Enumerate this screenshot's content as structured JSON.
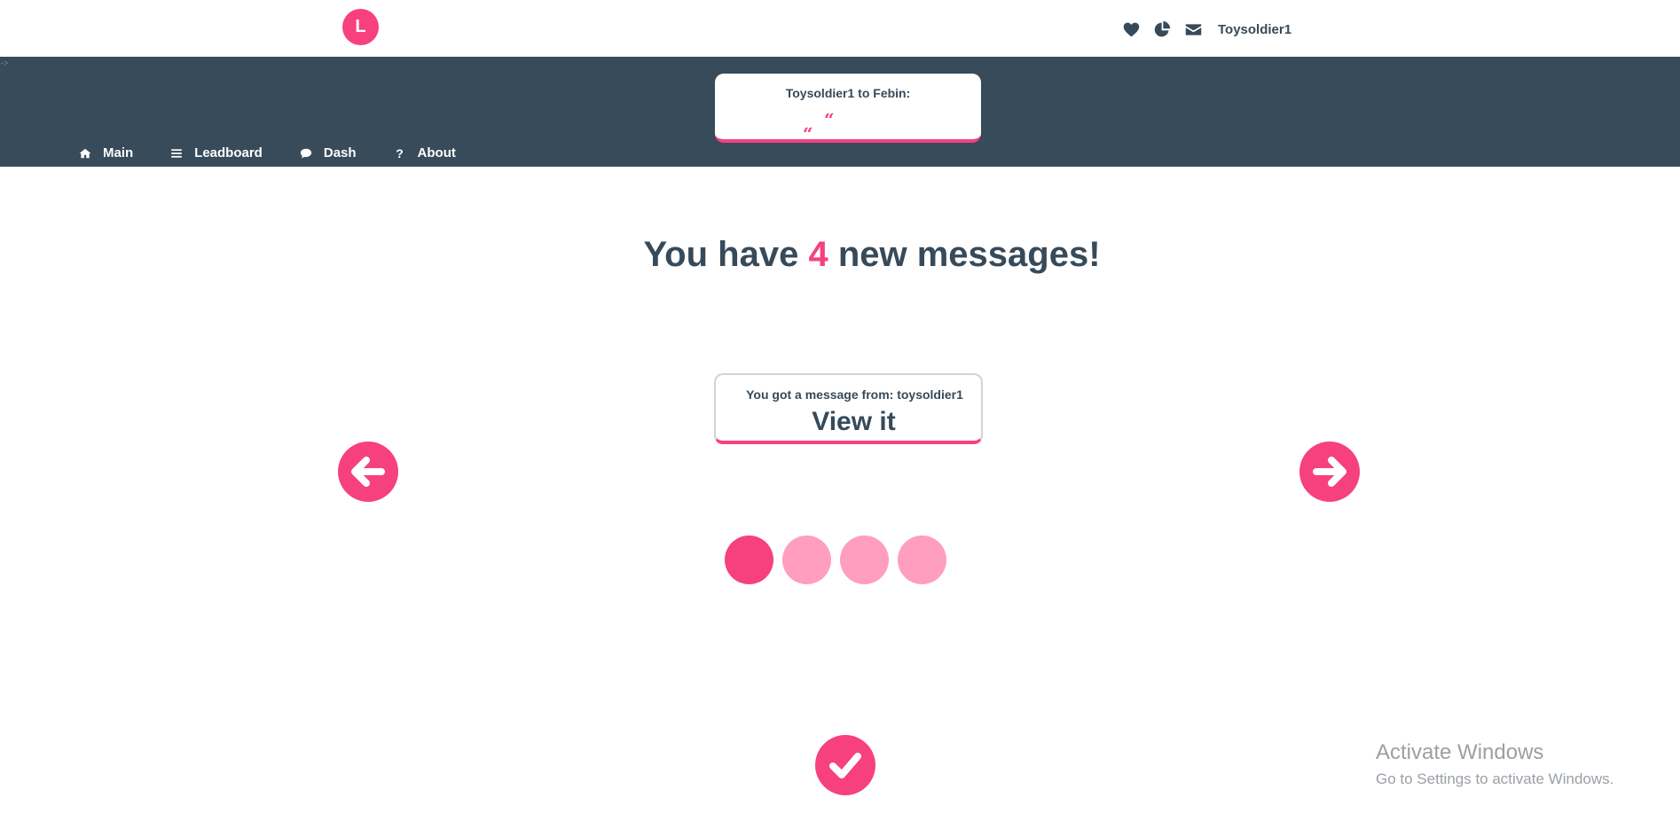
{
  "header": {
    "logo_letter": "L",
    "username": "Toysoldier1",
    "icons": [
      "heart-icon",
      "pie-chart-icon",
      "envelope-icon"
    ]
  },
  "band": {
    "artifact": "->",
    "quote_card": {
      "title": "Toysoldier1 to Febin:",
      "quote_mark_1": "“",
      "quote_mark_2": "“"
    }
  },
  "nav": {
    "items": [
      {
        "label": "Main",
        "icon": "home-icon"
      },
      {
        "label": "Leadboard",
        "icon": "list-icon"
      },
      {
        "label": "Dash",
        "icon": "comment-icon"
      },
      {
        "label": "About",
        "icon": "question-icon",
        "glyph": "?"
      }
    ]
  },
  "main": {
    "headline_prefix": "You have",
    "headline_count": "4",
    "headline_suffix": "new messages!",
    "message_card": {
      "from_text": "You got a message from: toysoldier1",
      "view_label": "View it"
    },
    "pagination": {
      "total": 4,
      "active_index": 0
    }
  },
  "colors": {
    "accent": "#f7407e",
    "accent_light": "#ff9ebf",
    "nav_bg": "#374b5a",
    "text": "#364a5a"
  },
  "watermark": {
    "title": "Activate Windows",
    "subtitle": "Go to Settings to activate Windows."
  }
}
